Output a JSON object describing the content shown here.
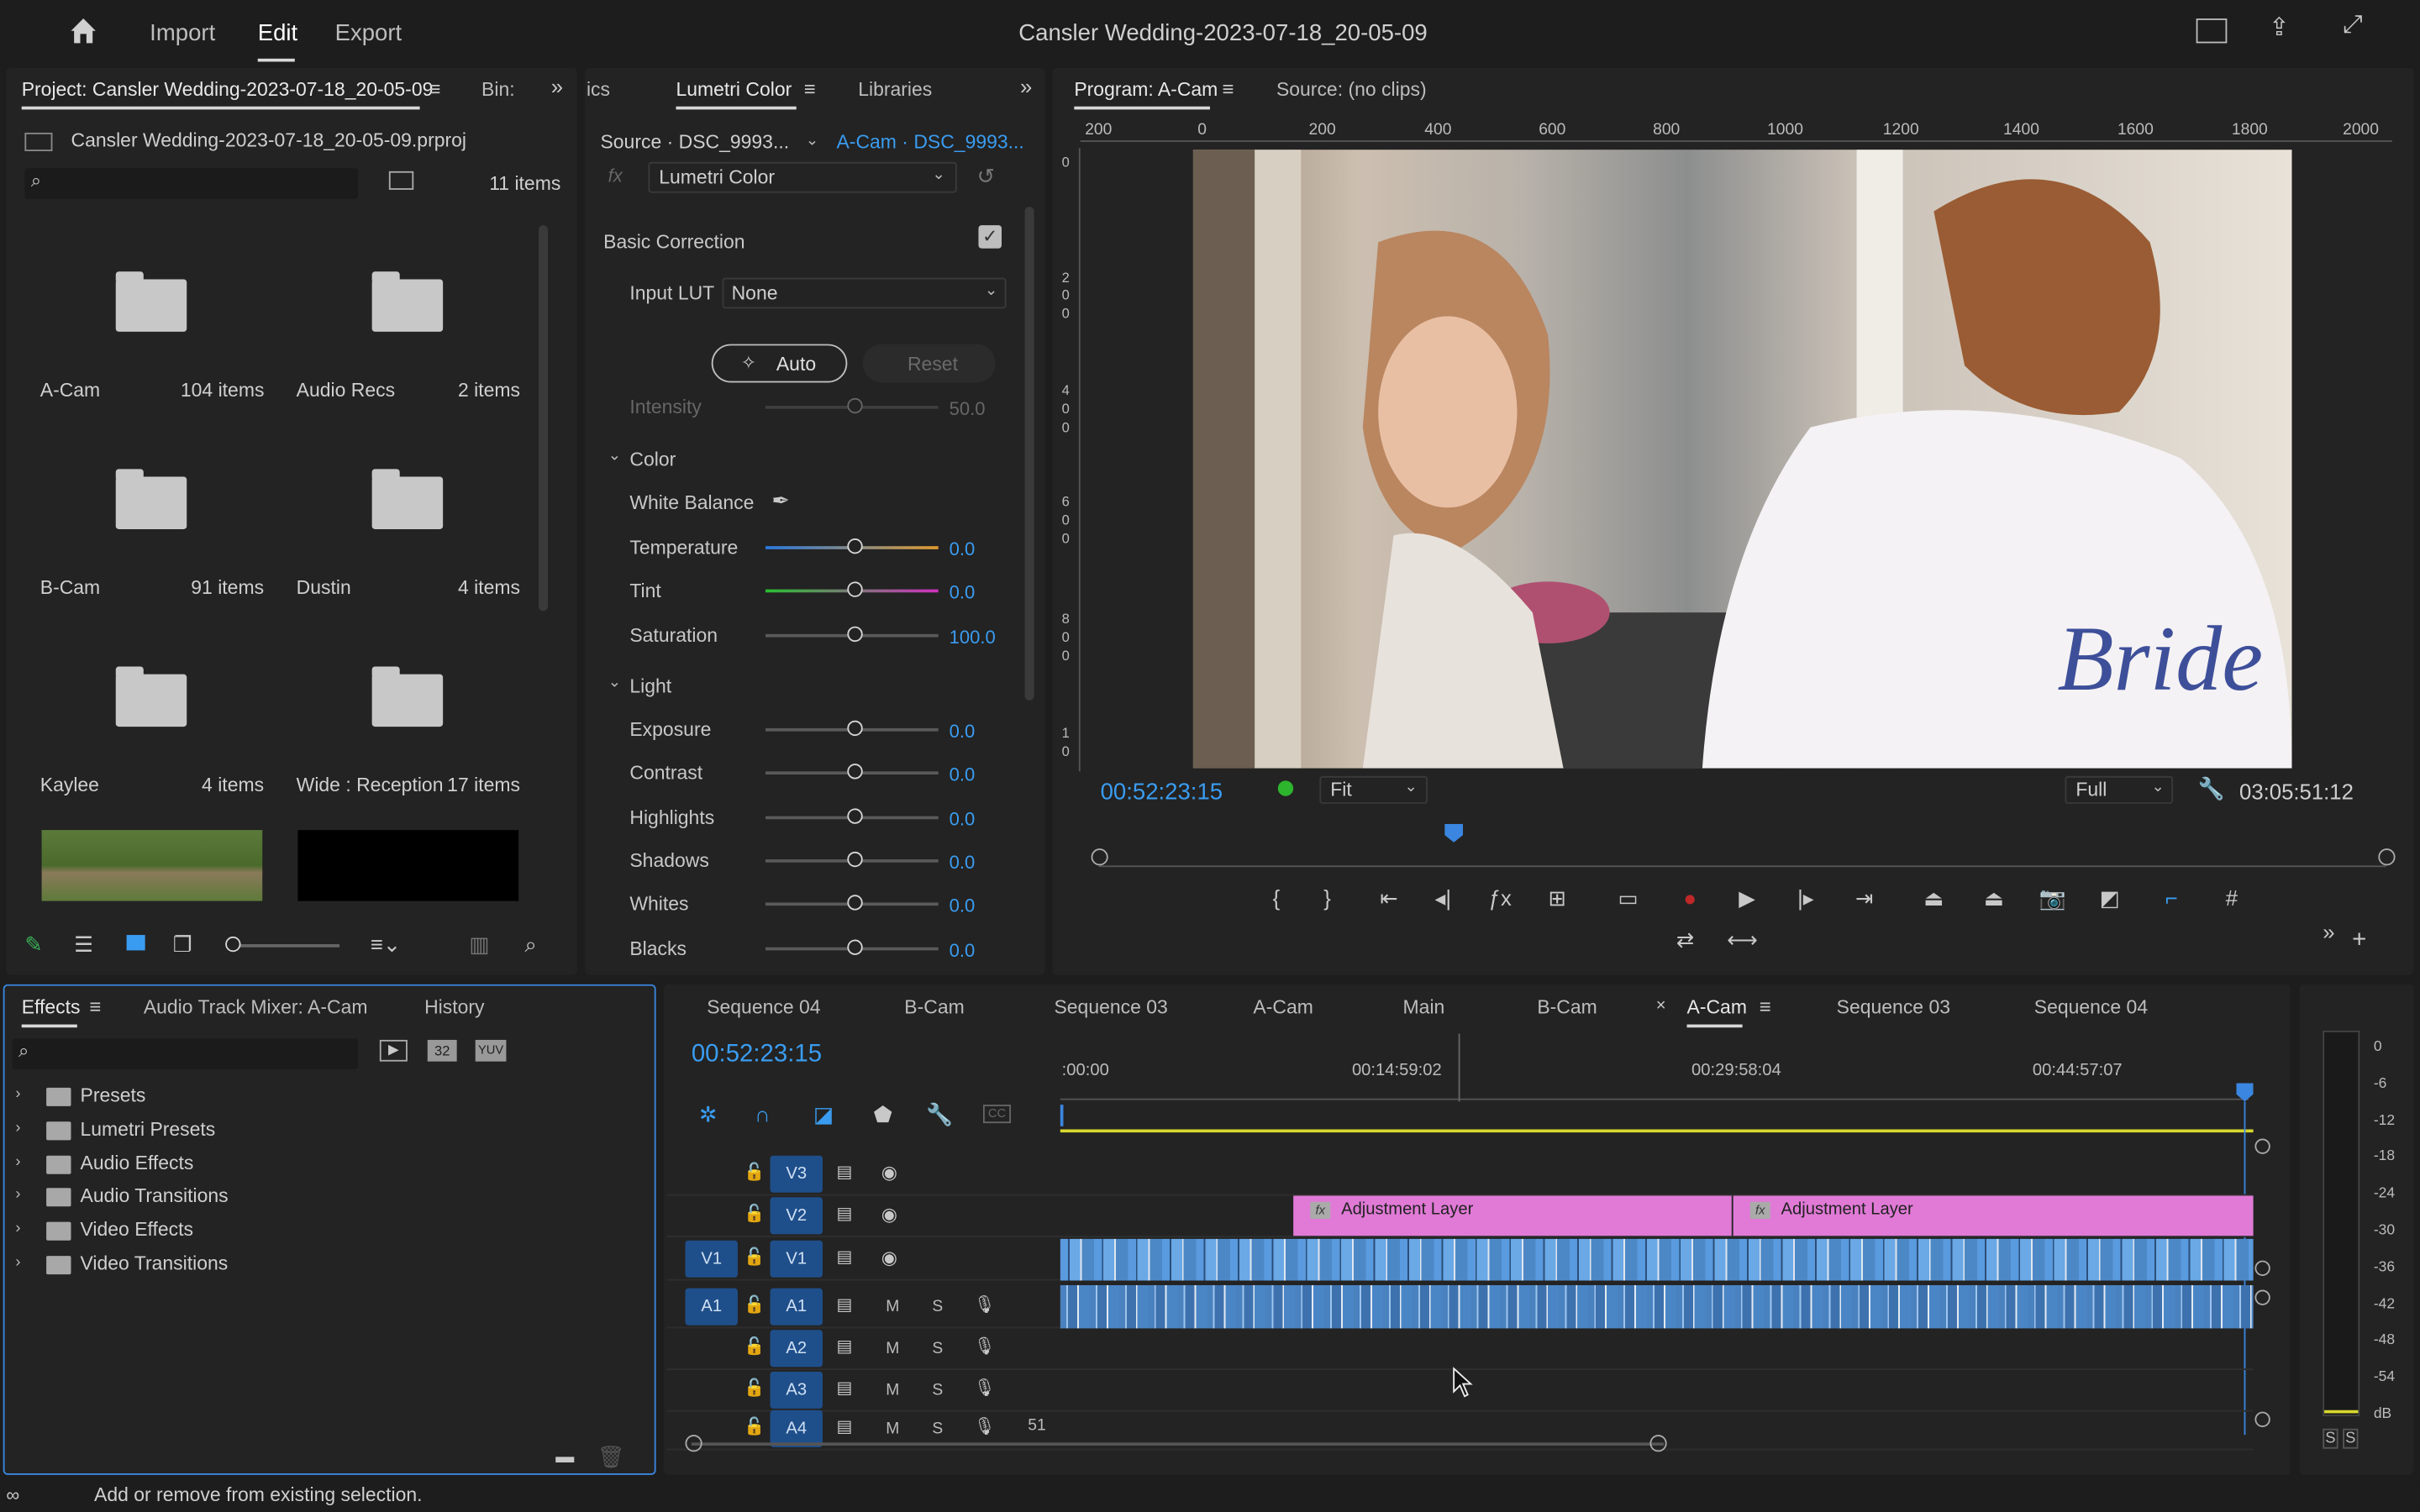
{
  "header": {
    "nav": [
      "Import",
      "Edit",
      "Export"
    ],
    "active": "Edit",
    "title": "Cansler Wedding-2023-07-18_20-05-09"
  },
  "project": {
    "tab_title": "Project: Cansler Wedding-2023-07-18_20-05-09",
    "bin_tab": "Bin:",
    "file": "Cansler Wedding-2023-07-18_20-05-09.prproj",
    "count": "11 items",
    "bins": [
      {
        "name": "A-Cam",
        "count": "104 items"
      },
      {
        "name": "Audio Recs",
        "count": "2 items"
      },
      {
        "name": "B-Cam",
        "count": "91 items"
      },
      {
        "name": "Dustin",
        "count": "4 items"
      },
      {
        "name": "Kaylee",
        "count": "4 items"
      },
      {
        "name": "Wide : Reception",
        "count": "17 items"
      }
    ]
  },
  "lumetri": {
    "tabs": [
      "ics",
      "Lumetri Color",
      "Libraries"
    ],
    "source": "Source · DSC_9993...",
    "target": "A-Cam · DSC_9993...",
    "effect": "Lumetri Color",
    "section": "Basic Correction",
    "input_lut_label": "Input LUT",
    "input_lut": "None",
    "auto": "Auto",
    "reset": "Reset",
    "intensity_label": "Intensity",
    "intensity": "50.0",
    "color_header": "Color",
    "wb_label": "White Balance",
    "color": [
      {
        "label": "Temperature",
        "value": "0.0"
      },
      {
        "label": "Tint",
        "value": "0.0"
      },
      {
        "label": "Saturation",
        "value": "100.0"
      }
    ],
    "light_header": "Light",
    "light": [
      {
        "label": "Exposure",
        "value": "0.0"
      },
      {
        "label": "Contrast",
        "value": "0.0"
      },
      {
        "label": "Highlights",
        "value": "0.0"
      },
      {
        "label": "Shadows",
        "value": "0.0"
      },
      {
        "label": "Whites",
        "value": "0.0"
      },
      {
        "label": "Blacks",
        "value": "0.0"
      }
    ]
  },
  "program": {
    "tab": "Program: A-Cam",
    "source_tab": "Source: (no clips)",
    "ruler": [
      "200",
      "0",
      "200",
      "400",
      "600",
      "800",
      "1000",
      "1200",
      "1400",
      "1600",
      "1800",
      "2000"
    ],
    "vruler": [
      "0",
      "2",
      "0",
      "0",
      "4",
      "0",
      "0",
      "6",
      "0",
      "0",
      "8",
      "0",
      "0",
      "1",
      "0"
    ],
    "timecode": "00:52:23:15",
    "fit": "Fit",
    "full": "Full",
    "duration": "03:05:51:12",
    "caption": "Bride"
  },
  "effects": {
    "tabs": [
      "Effects",
      "Audio Track Mixer: A-Cam",
      "History"
    ],
    "badges": [
      "32",
      "YUV"
    ],
    "items": [
      "Presets",
      "Lumetri Presets",
      "Audio Effects",
      "Audio Transitions",
      "Video Effects",
      "Video Transitions"
    ]
  },
  "timeline": {
    "tabs": [
      "Sequence 04",
      "B-Cam",
      "Sequence 03",
      "A-Cam",
      "Main",
      "B-Cam",
      "A-Cam",
      "Sequence 03",
      "Sequence 04"
    ],
    "active_index": 6,
    "timecode": "00:52:23:15",
    "ruler": [
      ":00:00",
      "00:14:59:02",
      "00:29:58:04",
      "00:44:57:07"
    ],
    "tracks": [
      {
        "name": "V3"
      },
      {
        "name": "V2"
      },
      {
        "name": "V1",
        "src": "V1"
      },
      {
        "name": "A1",
        "src": "A1"
      },
      {
        "name": "A2"
      },
      {
        "name": "A3"
      },
      {
        "name": "A4"
      }
    ],
    "track_letters": {
      "mute": "M",
      "solo": "S"
    },
    "a4_value": "51",
    "clips": [
      "Adjustment Layer",
      "Adjustment Layer"
    ]
  },
  "meter": {
    "scale": [
      "0",
      "-6",
      "-12",
      "-18",
      "-24",
      "-30",
      "-36",
      "-42",
      "-48",
      "-54",
      "dB"
    ],
    "solo": [
      "S",
      "S"
    ]
  },
  "status": "Add or remove from existing selection."
}
